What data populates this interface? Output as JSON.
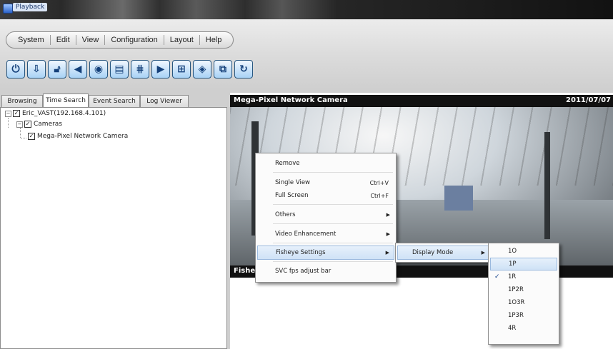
{
  "window": {
    "title": "Playback"
  },
  "menu": [
    "System",
    "Edit",
    "View",
    "Configuration",
    "Layout",
    "Help"
  ],
  "toolbar": {
    "buttons": [
      "power-icon",
      "export-icon",
      "lock-icon",
      "audio-icon",
      "snapshot-icon",
      "print-icon",
      "grid-icon",
      "video-icon",
      "layout-icon",
      "fullscreen-icon",
      "sync-icon",
      "refresh-icon"
    ]
  },
  "tabs": [
    "Browsing",
    "Time Search",
    "Event Search",
    "Log Viewer"
  ],
  "active_tab": "Time Search",
  "tree": {
    "root": "Eric_VAST(192.168.4.101)",
    "group": "Cameras",
    "camera": "Mega-Pixel Network Camera"
  },
  "video": {
    "camera_name": "Mega-Pixel Network Camera",
    "date": "2011/07/07",
    "bottom_label": "Fishe"
  },
  "context_menu": {
    "items": [
      {
        "label": "Remove",
        "shortcut": ""
      },
      {
        "label": "Single View",
        "shortcut": "Ctrl+V"
      },
      {
        "label": "Full Screen",
        "shortcut": "Ctrl+F"
      },
      {
        "label": "Others",
        "shortcut": ""
      },
      {
        "label": "Video Enhancement",
        "shortcut": ""
      },
      {
        "label": "Fisheye Settings",
        "shortcut": ""
      },
      {
        "label": "SVC fps adjust bar",
        "shortcut": ""
      }
    ],
    "submenu_label": "Display Mode",
    "display_modes": [
      "1O",
      "1P",
      "1R",
      "1P2R",
      "1O3R",
      "1P3R",
      "4R"
    ],
    "selected_mode": "1R",
    "highlighted_mode": "1P"
  },
  "colors": {
    "accent": "#2a62c9",
    "highlight": "#cfe2f6",
    "header_bg": "#111111"
  }
}
